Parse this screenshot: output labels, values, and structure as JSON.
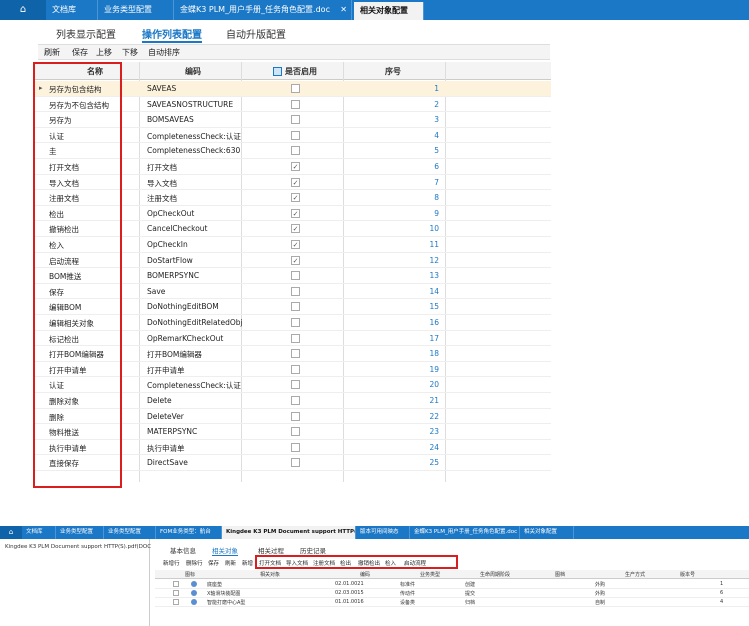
{
  "top_tabs": {
    "home_icon": "home-icon",
    "items": [
      {
        "label": "文档库"
      },
      {
        "label": "业务类型配置"
      },
      {
        "label": "金蝶K3 PLM_用户手册_任务角色配置.doc"
      },
      {
        "label": "相关对象配置",
        "active": true
      }
    ],
    "close_glyph": "✕"
  },
  "sub_tabs": [
    "列表显示配置",
    "操作列表配置",
    "自动升版配置"
  ],
  "toolbar": [
    "刷新",
    "保存",
    "上移",
    "下移",
    "自动排序"
  ],
  "grid": {
    "headers": {
      "name": "名称",
      "code": "编码",
      "enabled": "是否启用",
      "seq": "序号"
    },
    "rows": [
      {
        "name": "另存为包含结构",
        "code": "SAVEAS",
        "enabled": false,
        "seq": "1"
      },
      {
        "name": "另存为不包含结构",
        "code": "SAVEASNOSTRUCTURE",
        "enabled": false,
        "seq": "2"
      },
      {
        "name": "另存为",
        "code": "BOMSAVEAS",
        "enabled": false,
        "seq": "3"
      },
      {
        "name": "认证",
        "code": "CompletenessCheck:认证",
        "enabled": false,
        "seq": "4"
      },
      {
        "name": "圭",
        "code": "CompletenessCheck:630",
        "enabled": false,
        "seq": "5"
      },
      {
        "name": "打开文档",
        "code": "打开文档",
        "enabled": true,
        "seq": "6"
      },
      {
        "name": "导入文档",
        "code": "导入文档",
        "enabled": true,
        "seq": "7"
      },
      {
        "name": "注册文档",
        "code": "注册文档",
        "enabled": true,
        "seq": "8"
      },
      {
        "name": "检出",
        "code": "OpCheckOut",
        "enabled": true,
        "seq": "9"
      },
      {
        "name": "撤销检出",
        "code": "CancelCheckout",
        "enabled": true,
        "seq": "10"
      },
      {
        "name": "检入",
        "code": "OpCheckIn",
        "enabled": true,
        "seq": "11"
      },
      {
        "name": "启动流程",
        "code": "DoStartFlow",
        "enabled": true,
        "seq": "12"
      },
      {
        "name": "BOM推送",
        "code": "BOMERPSYNC",
        "enabled": false,
        "seq": "13"
      },
      {
        "name": "保存",
        "code": "Save",
        "enabled": false,
        "seq": "14"
      },
      {
        "name": "编辑BOM",
        "code": "DoNothingEditBOM",
        "enabled": false,
        "seq": "15"
      },
      {
        "name": "编辑相关对象",
        "code": "DoNothingEditRelatedObje",
        "enabled": false,
        "seq": "16"
      },
      {
        "name": "标记检出",
        "code": "OpRemarKCheckOut",
        "enabled": false,
        "seq": "17"
      },
      {
        "name": "打开BOM编辑器",
        "code": "打开BOM编辑器",
        "enabled": false,
        "seq": "18"
      },
      {
        "name": "打开申请单",
        "code": "打开申请单",
        "enabled": false,
        "seq": "19"
      },
      {
        "name": "认证",
        "code": "CompletenessCheck:认证",
        "enabled": false,
        "seq": "20"
      },
      {
        "name": "删除对象",
        "code": "Delete",
        "enabled": false,
        "seq": "21"
      },
      {
        "name": "删除",
        "code": "DeleteVer",
        "enabled": false,
        "seq": "22"
      },
      {
        "name": "物料推送",
        "code": "MATERPSYNC",
        "enabled": false,
        "seq": "23"
      },
      {
        "name": "执行申请单",
        "code": "执行申请单",
        "enabled": false,
        "seq": "24"
      },
      {
        "name": "直接保存",
        "code": "DirectSave",
        "enabled": false,
        "seq": "25"
      }
    ]
  },
  "lower": {
    "tabs": [
      "文档库",
      "业务类型配置",
      "业务类型配置",
      "FOM业务类型：航台",
      "Kingdee K3 PLM Document support HTTP(S).pdf",
      "版本可用间映态",
      "金蝶K3 PLM_用户手册_任务角色配置.doc",
      "相关对象配置"
    ],
    "tree_item": "Kingdee K3 PLM Document support HTTP(S).pdf(DOC",
    "sub_tabs": [
      "基本信息",
      "相关对象",
      "相关过程",
      "历史记录"
    ],
    "toolbar_left": [
      "新增行",
      "删除行",
      "保存",
      "刷新",
      "新增"
    ],
    "toolbar_boxed": [
      "打开文档",
      "导入文档",
      "注册文档",
      "检出",
      "撤销检出",
      "检入",
      "启动流程"
    ],
    "headers": [
      "图标",
      "相关对象",
      "编码",
      "业务类型",
      "生命周期阶段",
      "图档",
      "生产方式",
      "版本号"
    ],
    "rows": [
      {
        "name": "底座垫",
        "code": "02.01.0021",
        "type": "标准件",
        "stage": "创建",
        "mode": "外购",
        "ver": "1"
      },
      {
        "name": "X轴滑块装配图",
        "code": "02.03.0015",
        "type": "传动件",
        "stage": "提交",
        "mode": "外购",
        "ver": "6"
      },
      {
        "name": "智能打磨中心A型",
        "code": "01.01.0016",
        "type": "设备类",
        "stage": "归档",
        "mode": "自制",
        "ver": "4"
      }
    ]
  },
  "colors": {
    "accent": "#1b78c6",
    "highlight": "#d81e1e",
    "selected_row": "#fdf3dd"
  }
}
